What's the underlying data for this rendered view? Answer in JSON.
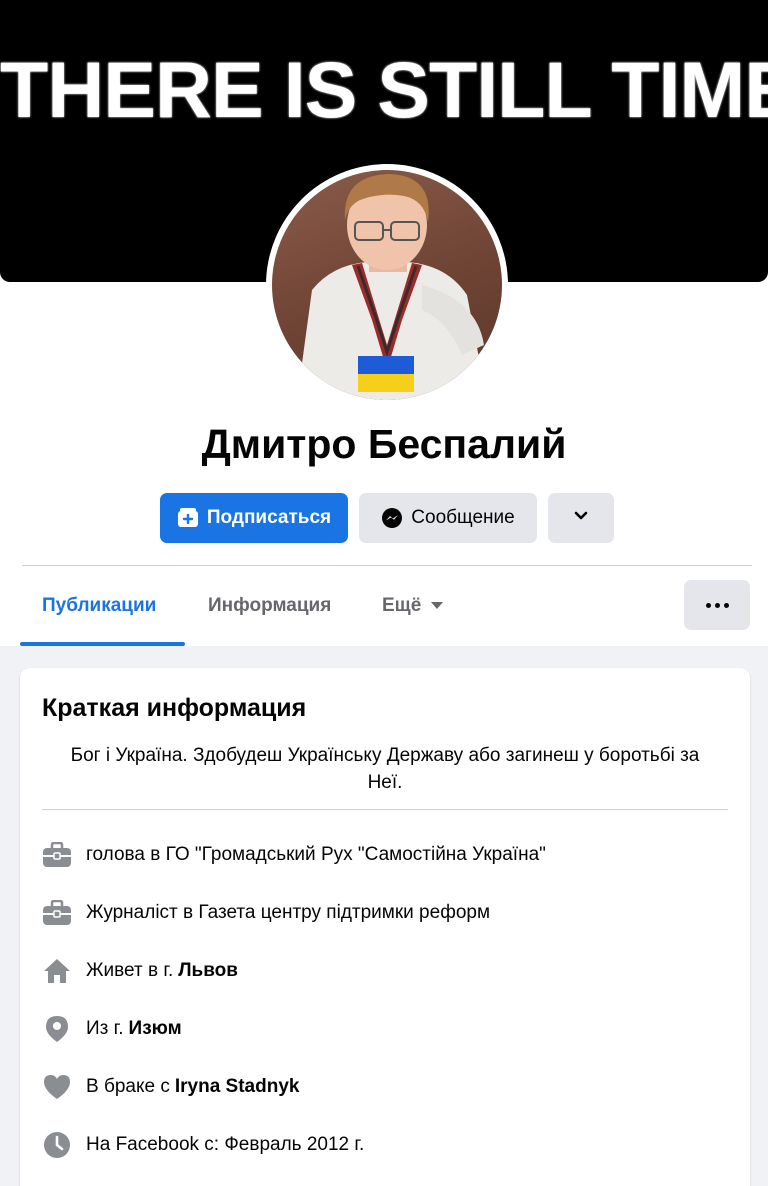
{
  "cover": {
    "text": "THERE IS STILL TIME"
  },
  "profile": {
    "name": "Дмитро Беспалий"
  },
  "actions": {
    "subscribe_label": "Подписаться",
    "message_label": "Сообщение"
  },
  "tabs": [
    {
      "label": "Публикации",
      "active": true
    },
    {
      "label": "Информация",
      "active": false
    },
    {
      "label": "Ещё",
      "active": false
    }
  ],
  "intro": {
    "title": "Краткая информация",
    "bio_line1": "Бог і Україна. Здобудеш Українську Державу або загинеш у боротьбі за",
    "bio_line2": "Неї.",
    "items": [
      {
        "icon": "briefcase-icon",
        "text": "голова в ГО \"Громадський Рух \"Самостійна Україна\"",
        "bold": ""
      },
      {
        "icon": "briefcase-icon",
        "text": "Журналіст в Газета центру підтримки реформ",
        "bold": ""
      },
      {
        "icon": "home-icon",
        "text": "Живет в г.",
        "bold": "Львов"
      },
      {
        "icon": "location-pin-icon",
        "text": "Из г.",
        "bold": "Изюм"
      },
      {
        "icon": "heart-icon",
        "text": "В браке с",
        "bold": "Iryna Stadnyk"
      },
      {
        "icon": "clock-icon",
        "text": "На Facebook с: Февраль 2012 г.",
        "bold": ""
      }
    ]
  },
  "colors": {
    "accent": "#1b74e4",
    "secondary_button": "#e4e6eb",
    "icon_gray": "#8a8d91",
    "page_background": "#f0f2f5"
  }
}
